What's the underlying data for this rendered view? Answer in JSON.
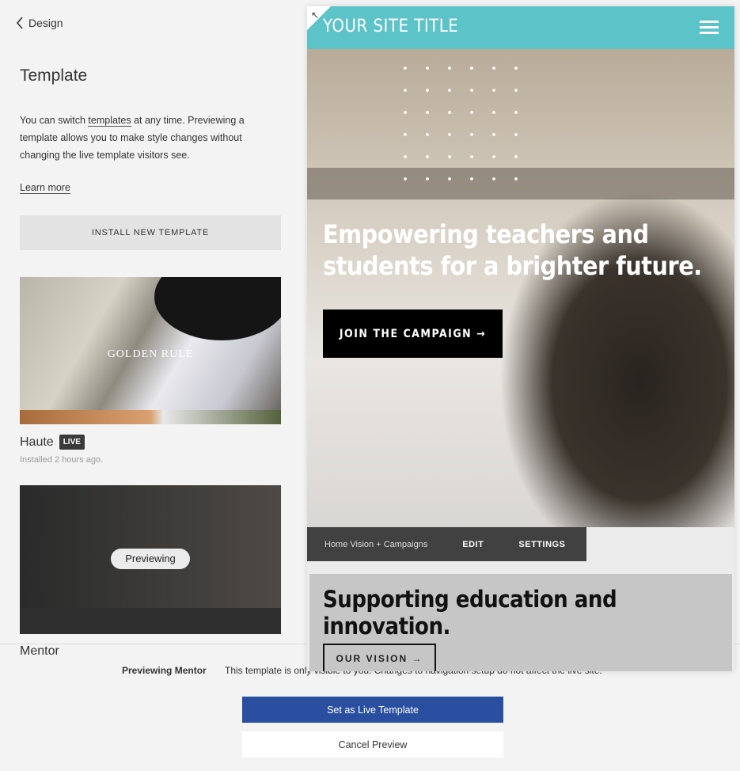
{
  "nav": {
    "back_label": "Design"
  },
  "panel": {
    "title": "Template",
    "desc_before": "You can switch ",
    "desc_link": "templates",
    "desc_after": " at any time. Previewing a template allows you to make style changes without changing the live template visitors see.",
    "learn_more": "Learn more",
    "install_button": "INSTALL NEW TEMPLATE"
  },
  "templates": [
    {
      "name": "Haute",
      "badge": "LIVE",
      "installed": "Installed 2 hours ago.",
      "thumb_text": "GOLDEN RULE"
    },
    {
      "name": "Mentor",
      "overlay": "Previewing"
    }
  ],
  "preview": {
    "site_title": "YOUR SITE TITLE",
    "accent_color": "#5cc3c9",
    "hero_title": "Empowering teachers and students for a brighter future.",
    "hero_button": "JOIN THE CAMPAIGN →",
    "toolbar": {
      "page": "Home Vision + Campaigns",
      "edit": "EDIT",
      "settings": "SETTINGS"
    },
    "section_title": "Supporting education and innovation.",
    "section_button": "OUR VISION →"
  },
  "footer": {
    "previewing_label": "Previewing Mentor",
    "message": "This template is only visible to you. Changes to navigation setup do not affect the live site.",
    "set_live": "Set as Live Template",
    "cancel": "Cancel Preview",
    "primary_color": "#2a4fa0"
  }
}
